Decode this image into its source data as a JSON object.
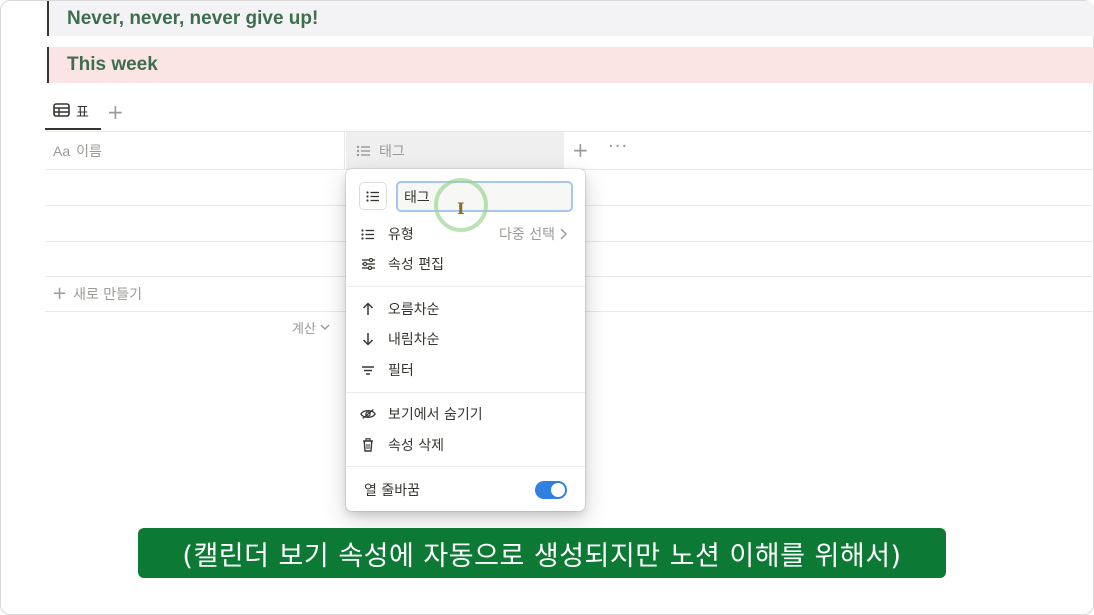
{
  "callouts": [
    {
      "text": "Never, never, never give up!"
    },
    {
      "text": "This week"
    }
  ],
  "view_tabs": {
    "active_label": "표",
    "add_symbol": "+"
  },
  "table": {
    "columns": [
      {
        "icon": "text-icon",
        "icon_text": "Aa",
        "label": "이름"
      },
      {
        "icon": "list-icon",
        "label": "태그"
      }
    ],
    "add_column_symbol": "+",
    "more_symbol": "···",
    "new_row_label": "새로 만들기",
    "calc_label": "계산"
  },
  "property_menu": {
    "name_value": "태그",
    "type_label": "유형",
    "type_value": "다중 선택",
    "edit_label": "속성 편집",
    "sort_asc_label": "오름차순",
    "sort_desc_label": "내림차순",
    "filter_label": "필터",
    "hide_label": "보기에서 숨기기",
    "delete_label": "속성 삭제",
    "wrap_label": "열 줄바꿈",
    "wrap_on": true
  },
  "subtitle": "(캘린더 보기 속성에 자동으로 생성되지만 노션 이해를 위해서)",
  "colors": {
    "callout_text": "#3f6e4f",
    "callout_2_bg": "#fbe4e4",
    "toggle_on": "#2f80e0",
    "subtitle_bg": "#0c7a34"
  }
}
